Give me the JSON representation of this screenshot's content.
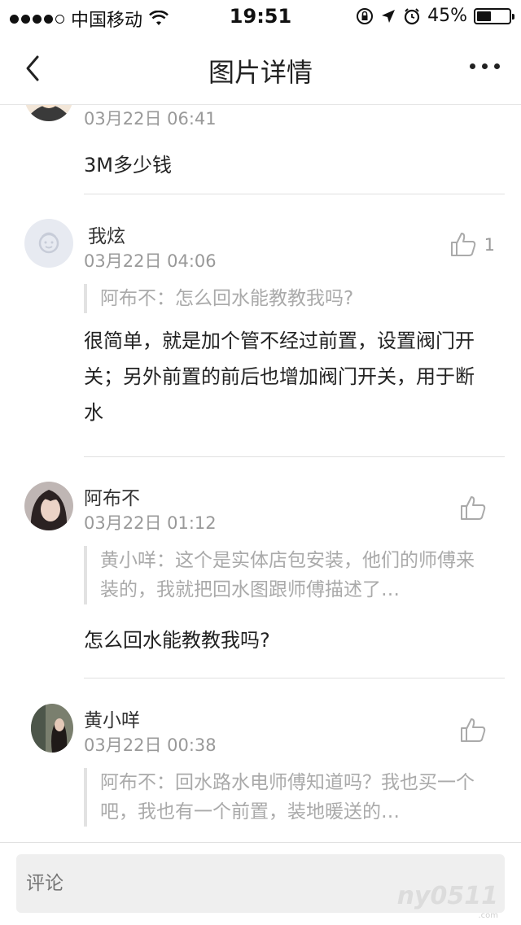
{
  "status_bar": {
    "carrier": "中国移动",
    "time": "19:51",
    "battery_text": "45%",
    "battery_level": 0.45,
    "signal_bars_filled": 4,
    "signal_bars_total": 5
  },
  "nav": {
    "title": "图片详情",
    "back_icon": "chevron-left-icon",
    "more_icon": "more-dots-icon"
  },
  "comments": [
    {
      "name": "",
      "time": "03月22日 06:41",
      "text": "3M多少钱",
      "quote": "",
      "likes": ""
    },
    {
      "name": "我炫",
      "time": "03月22日 04:06",
      "quote": "阿布不：怎么回水能教教我吗?",
      "text": "很简单，就是加个管不经过前置，设置阀门开关；另外前置的前后也增加阀门开关，用于断水",
      "likes": "1"
    },
    {
      "name": "阿布不",
      "time": "03月22日 01:12",
      "quote": "黄小咩：这个是实体店包安装，他们的师傅来装的，我就把回水图跟师傅描述了…",
      "text": "怎么回水能教教我吗?",
      "likes": ""
    },
    {
      "name": "黄小咩",
      "time": "03月22日 00:38",
      "quote": "阿布不：回水路水电师傅知道吗？我也买一个吧，我也有一个前置，装地暖送的…",
      "text": "",
      "likes": ""
    }
  ],
  "bottom": {
    "comment_placeholder": "评论",
    "watermark": "ny0511",
    "watermark_sub": ".com"
  },
  "colors": {
    "accent_text": "#222222",
    "muted_text": "#999999",
    "quote_text": "#aaaaaa",
    "divider": "#e0e0e0",
    "input_bg": "#efefef"
  }
}
